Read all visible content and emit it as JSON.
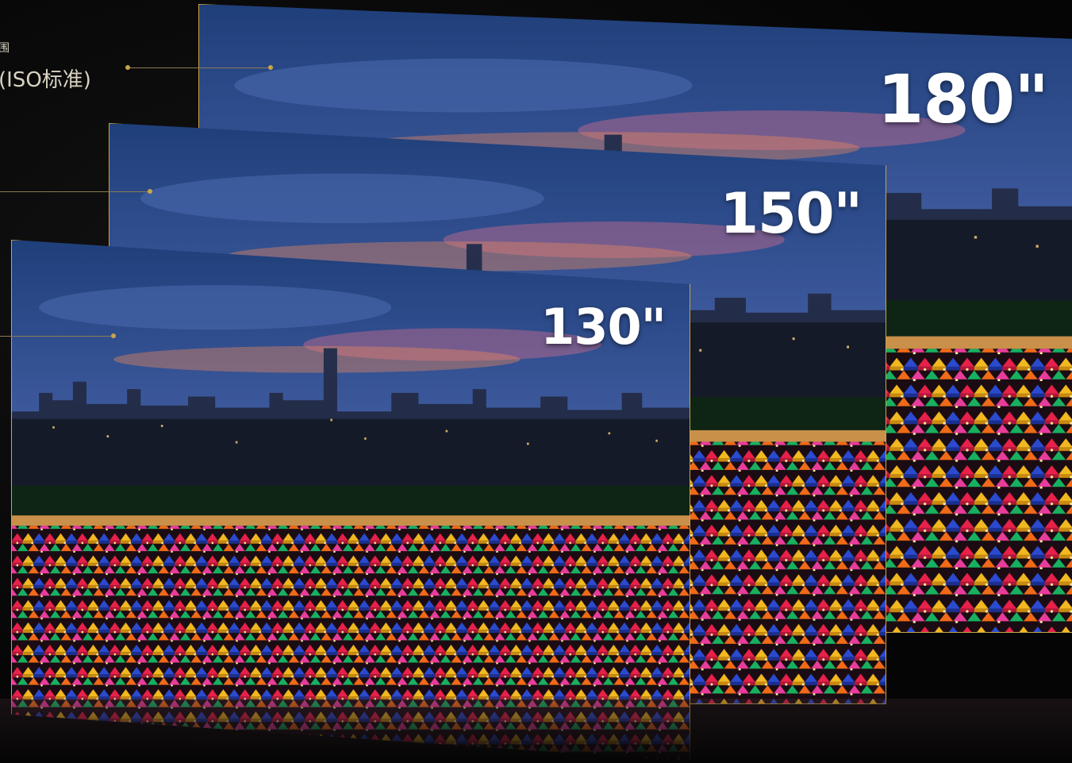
{
  "screens": [
    {
      "id": "180",
      "label": "180\""
    },
    {
      "id": "150",
      "label": "150\""
    },
    {
      "id": "130",
      "label": "130\""
    }
  ],
  "callouts": {
    "partial_top": "围",
    "iso_standard": "(ISO标准)"
  },
  "colors": {
    "frame_accent": "#c8a54a",
    "background": "#050505"
  }
}
